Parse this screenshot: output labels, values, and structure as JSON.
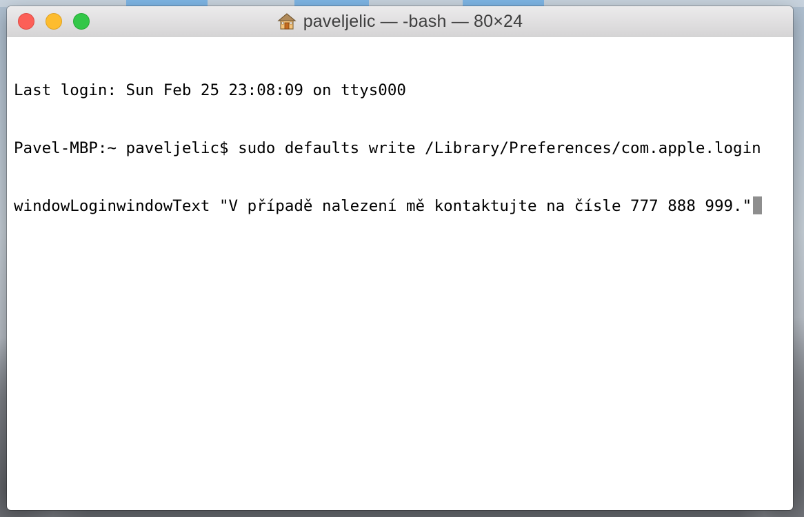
{
  "window": {
    "title": "paveljelic — -bash — 80×24",
    "title_icon": "home-folder-icon"
  },
  "traffic_lights": {
    "close_color": "#fc5f57",
    "minimize_color": "#fdbc2e",
    "zoom_color": "#33c748"
  },
  "terminal": {
    "lines": [
      "Last login: Sun Feb 25 23:08:09 on ttys000",
      "Pavel-MBP:~ paveljelic$ sudo defaults write /Library/Preferences/com.apple.login",
      "windowLoginwindowText \"V případě nalezení mě kontaktujte na čísle 777 888 999.\""
    ],
    "cursor": "block-cursor"
  }
}
